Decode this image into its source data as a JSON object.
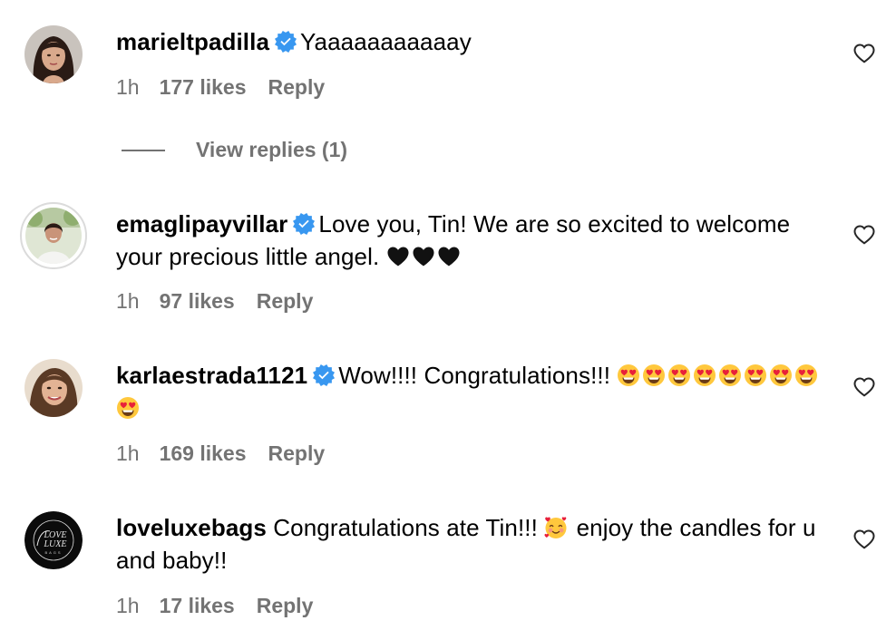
{
  "comments": [
    {
      "username": "marieltpadilla",
      "verified": true,
      "text": "Yaaaaaaaaaaay",
      "time": "1h",
      "likes": "177 likes",
      "reply": "Reply",
      "view_replies": "View replies (1)"
    },
    {
      "username": "emaglipayvillar",
      "verified": true,
      "text": "Love you, Tin! We are so excited to welcome your precious little angel.",
      "emoji": "🖤🖤🖤",
      "time": "1h",
      "likes": "97 likes",
      "reply": "Reply"
    },
    {
      "username": "karlaestrada1121",
      "verified": true,
      "text": "Wow!!!! Congratulations!!!",
      "emoji": "😍😍😍😍😍😍😍😍😍",
      "time": "1h",
      "likes": "169 likes",
      "reply": "Reply"
    },
    {
      "username": "loveluxebags",
      "verified": false,
      "text_before_emoji": "Congratulations ate Tin!!!",
      "emoji": "🥰",
      "text_after_emoji": "enjoy the candles for u and baby!!",
      "time": "1h",
      "likes": "17 likes",
      "reply": "Reply",
      "avatar_logo": {
        "line1": "LOVE",
        "line2": "LUXE",
        "line3": "BAGS"
      }
    }
  ],
  "icons": {
    "verified": "verified-badge-icon",
    "like": "heart-outline-icon",
    "heart_emoji": "black-heart-emoji",
    "heart_eyes_emoji": "heart-eyes-emoji",
    "hearts_face_emoji": "smiling-face-with-hearts-emoji"
  },
  "colors": {
    "text": "#000000",
    "meta": "#737373",
    "verified": "#3897f0",
    "avatar_ring": "#dbdbdb"
  }
}
